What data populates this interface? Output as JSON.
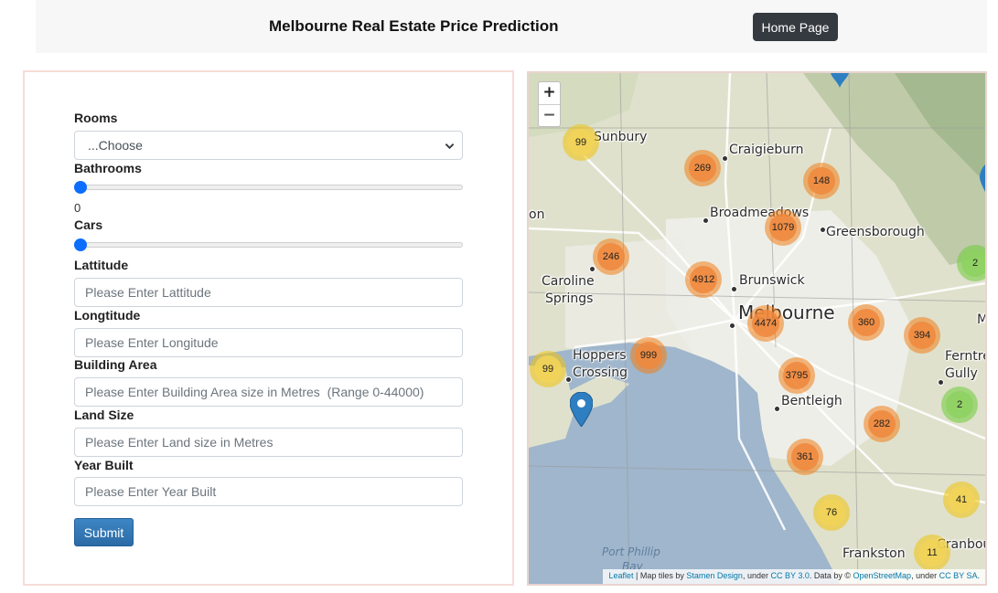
{
  "header": {
    "title": "Melbourne Real Estate Price Prediction",
    "home_button": "Home Page"
  },
  "form": {
    "rooms": {
      "label": "Rooms",
      "selected": "...Choose"
    },
    "bathrooms": {
      "label": "Bathrooms",
      "value": "0"
    },
    "cars": {
      "label": "Cars"
    },
    "latitude": {
      "label": "Lattitude",
      "placeholder": "Please Enter Lattitude"
    },
    "longitude": {
      "label": "Longtitude",
      "placeholder": "Please Enter Longitude"
    },
    "building_area": {
      "label": "Building Area",
      "placeholder": "Please Enter Building Area size in Metres  (Range 0-44000)"
    },
    "land_size": {
      "label": "Land Size",
      "placeholder": "Please Enter Land size in Metres"
    },
    "year_built": {
      "label": "Year Built",
      "placeholder": "Please Enter Year Built"
    },
    "submit": "Submit"
  },
  "map": {
    "zoom_in": "+",
    "zoom_out": "−",
    "places": {
      "sunbury": "Sunbury",
      "craigieburn": "Craigieburn",
      "broadmeadows": "Broadmeadows",
      "greensborough": "Greensborough",
      "caroline_springs_1": "Caroline",
      "caroline_springs_2": "Springs",
      "brunswick": "Brunswick",
      "melbourne": "Melbourne",
      "hoppers_crossing_1": "Hoppers",
      "hoppers_crossing_2": "Crossing",
      "ferntree_gully_1": "Ferntre",
      "ferntree_gully_2": "Gully",
      "bentleigh": "Bentleigh",
      "frankston": "Frankston",
      "cranbourne": "Cranbourn",
      "port_phillip_1": "Port Phillip",
      "port_phillip_2": "Bay",
      "left_edge": "on",
      "right_edge": "M"
    },
    "clusters": {
      "sunbury": "99",
      "craigieburn": "269",
      "northeast": "148",
      "broadmeadows": "1079",
      "caroline": "246",
      "brunswick": "4912",
      "east_edge": "2",
      "melbourne": "4474",
      "kew": "360",
      "ringwood": "394",
      "hoppers": "999",
      "werribee": "99",
      "bentleigh": "3795",
      "ferntree": "2",
      "dandenong": "282",
      "mentone": "361",
      "cranbourne_n": "41",
      "frankston_n": "76",
      "cranbourne": "11"
    },
    "attribution": {
      "leaflet": "Leaflet",
      "t1": "| Map tiles by",
      "stamen": "Stamen Design",
      "t2": ", under",
      "ccby": "CC BY 3.0",
      "t3": ". Data by ©",
      "osm": "OpenStreetMap",
      "t4": ", under",
      "ccbysa": "CC BY SA",
      "t5": "."
    }
  }
}
